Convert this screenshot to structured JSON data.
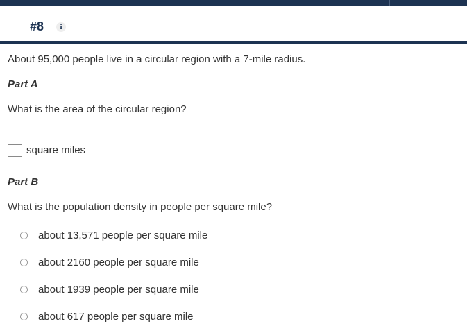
{
  "question": {
    "number": "#8",
    "info_icon": "i",
    "prompt": "About 95,000 people live in a circular region with a 7-mile radius."
  },
  "part_a": {
    "label": "Part A",
    "question": "What is the area of the circular region?",
    "answer_value": "",
    "unit": "square miles"
  },
  "part_b": {
    "label": "Part B",
    "question": "What is the population density in people per square mile?",
    "options": [
      {
        "label": "about 13,571 people per square mile"
      },
      {
        "label": "about 2160 people per square mile"
      },
      {
        "label": "about 1939 people per square mile"
      },
      {
        "label": "about 617 people per square mile"
      }
    ]
  },
  "colors": {
    "nav_bar": "#1d3352",
    "text": "#333333"
  }
}
